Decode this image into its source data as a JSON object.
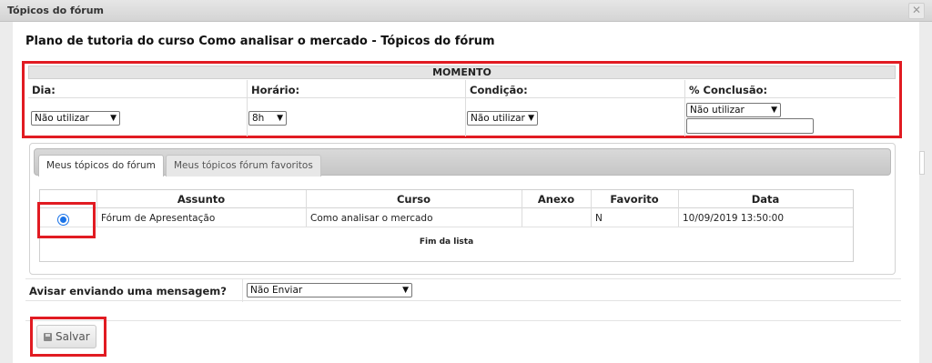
{
  "window": {
    "title": "Tópicos do fórum",
    "close_icon": "close-icon"
  },
  "heading": "Plano de tutoria do curso Como analisar o mercado - Tópicos do fórum",
  "moment": {
    "header": "MOMENTO",
    "dia": {
      "label": "Dia:",
      "value": "Não utilizar"
    },
    "horario": {
      "label": "Horário:",
      "value": "8h"
    },
    "condicao": {
      "label": "Condição:",
      "value": "Não utilizar"
    },
    "conclusao": {
      "label": "% Conclusão:",
      "value": "Não utilizar",
      "text": ""
    }
  },
  "tabs": [
    {
      "label": "Meus tópicos do fórum",
      "active": true
    },
    {
      "label": "Meus tópicos fórum favoritos",
      "active": false
    }
  ],
  "table": {
    "columns": [
      "Assunto",
      "Curso",
      "Anexo",
      "Favorito",
      "Data"
    ],
    "rows": [
      {
        "selected": true,
        "assunto": "Fórum de Apresentação",
        "curso": "Como analisar o mercado",
        "anexo": "",
        "favorito": "N",
        "data": "10/09/2019 13:50:00"
      }
    ],
    "footer": "Fim da lista"
  },
  "notify": {
    "label": "Avisar enviando uma mensagem?",
    "value": "Não Enviar"
  },
  "save": {
    "label": "Salvar",
    "icon": "disk-icon"
  },
  "colors": {
    "highlight": "#e11b22",
    "radio": "#1a73e8"
  }
}
